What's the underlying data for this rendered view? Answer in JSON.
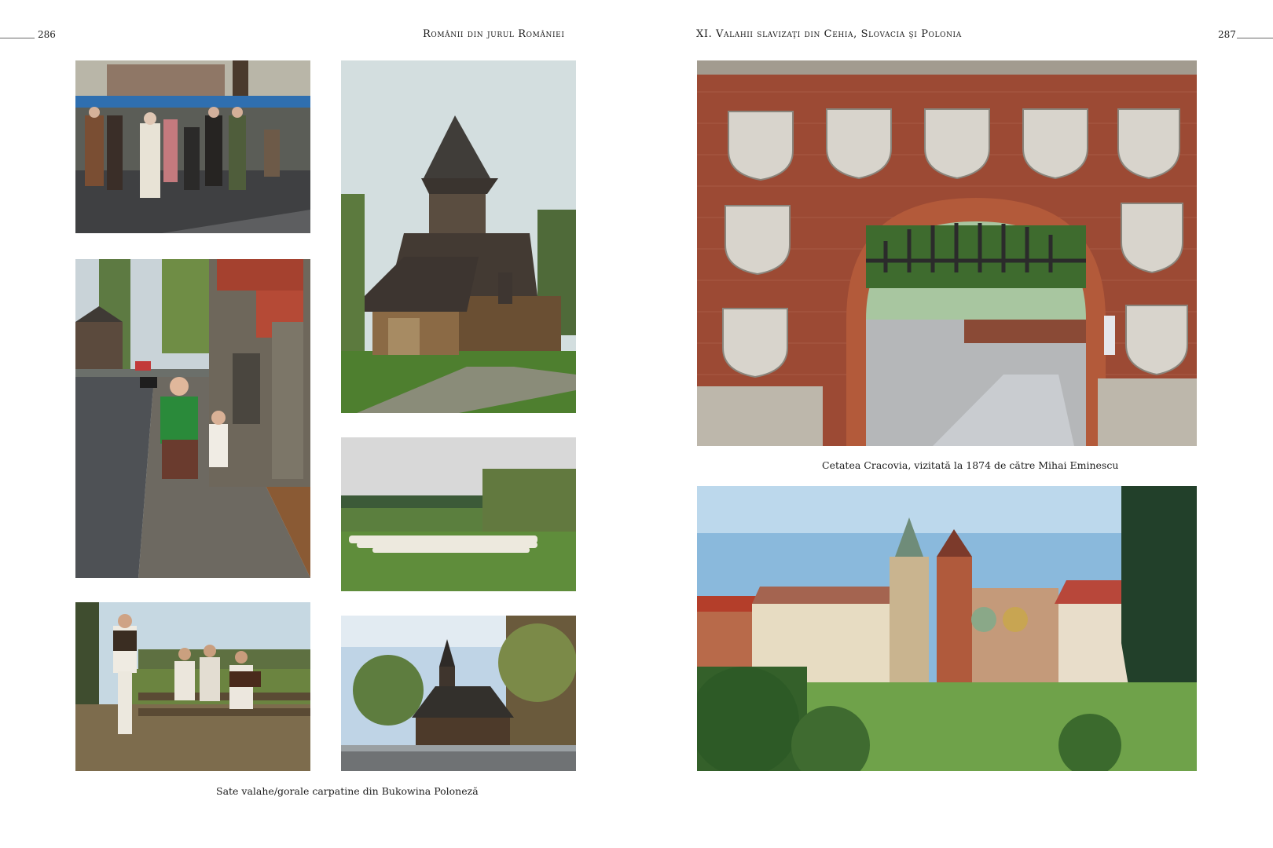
{
  "left_page": {
    "page_number": "286",
    "running_header": "Românii din jurul României",
    "caption": "Sate valahe/gorale carpatine din Bukowina Poloneză"
  },
  "right_page": {
    "page_number": "287",
    "running_header": "XI. Valahii slavizaţi din Cehia, Slovacia şi Polonia",
    "caption": "Cetatea Cracovia, vizitată la 1874 de către Mihai Eminescu"
  }
}
